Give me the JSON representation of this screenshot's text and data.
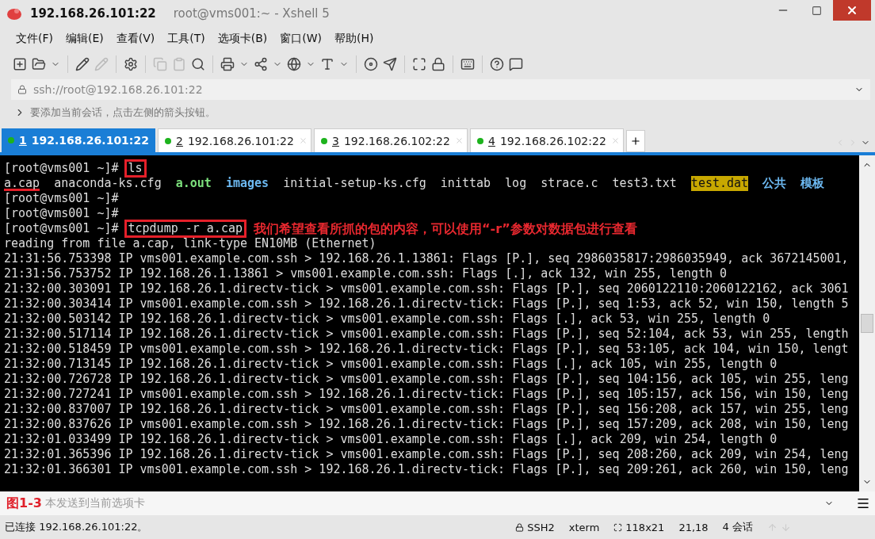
{
  "window": {
    "title": "192.168.26.101:22",
    "subtitle": "root@vms001:~ - Xshell 5"
  },
  "menu": [
    "文件(F)",
    "编辑(E)",
    "查看(V)",
    "工具(T)",
    "选项卡(B)",
    "窗口(W)",
    "帮助(H)"
  ],
  "address": {
    "value": "ssh://root@192.168.26.101:22"
  },
  "hint": "要添加当前会话，点击左侧的箭头按钮。",
  "tabs": [
    {
      "number": "1",
      "label": "192.168.26.101:22",
      "selected": true
    },
    {
      "number": "2",
      "label": "192.168.26.101:22",
      "selected": false
    },
    {
      "number": "3",
      "label": "192.168.26.102:22",
      "selected": false
    },
    {
      "number": "4",
      "label": "192.168.26.102:22",
      "selected": false
    }
  ],
  "terminal": [
    [
      {
        "kind": "plain",
        "text": "[root@vms001 ~]#"
      },
      {
        "kind": "command",
        "text": "ls"
      }
    ],
    [
      {
        "kind": "marked",
        "text": "a.cap"
      },
      {
        "kind": "file",
        "text": "anaconda-ks.cfg"
      },
      {
        "kind": "exec",
        "text": "a.out"
      },
      {
        "kind": "dir",
        "text": "images"
      },
      {
        "kind": "file",
        "text": "initial-setup-ks.cfg"
      },
      {
        "kind": "file",
        "text": "inittab"
      },
      {
        "kind": "file",
        "text": "log"
      },
      {
        "kind": "file",
        "text": "strace.c"
      },
      {
        "kind": "file",
        "text": "test3.txt"
      },
      {
        "kind": "highlight",
        "text": "test.dat"
      },
      {
        "kind": "dir",
        "text": "公共"
      },
      {
        "kind": "dir",
        "text": "模板"
      }
    ],
    [
      {
        "kind": "plain",
        "text": "[root@vms001 ~]#"
      }
    ],
    [
      {
        "kind": "plain",
        "text": "[root@vms001 ~]#"
      }
    ],
    [
      {
        "kind": "plain",
        "text": "[root@vms001 ~]#"
      },
      {
        "kind": "command",
        "text": "tcpdump -r a.cap"
      },
      {
        "kind": "note",
        "text": "我们希望查看所抓的包的内容，可以使用“-r”参数对数据包进行查看"
      }
    ],
    [
      {
        "kind": "plain",
        "text": "reading from file a.cap, link-type EN10MB (Ethernet)"
      }
    ],
    [
      {
        "kind": "plain",
        "text": "21:31:56.753398 IP vms001.example.com.ssh > 192.168.26.1.13861: Flags [P.], seq 2986035817:2986035949, ack 3672145001,"
      }
    ],
    [
      {
        "kind": "plain",
        "text": "21:31:56.753752 IP 192.168.26.1.13861 > vms001.example.com.ssh: Flags [.], ack 132, win 255, length 0"
      }
    ],
    [
      {
        "kind": "plain",
        "text": "21:32:00.303091 IP 192.168.26.1.directv-tick > vms001.example.com.ssh: Flags [P.], seq 2060122110:2060122162, ack 3061"
      }
    ],
    [
      {
        "kind": "plain",
        "text": "21:32:00.303414 IP vms001.example.com.ssh > 192.168.26.1.directv-tick: Flags [P.], seq 1:53, ack 52, win 150, length 5"
      }
    ],
    [
      {
        "kind": "plain",
        "text": "21:32:00.503142 IP 192.168.26.1.directv-tick > vms001.example.com.ssh: Flags [.], ack 53, win 255, length 0"
      }
    ],
    [
      {
        "kind": "plain",
        "text": "21:32:00.517114 IP 192.168.26.1.directv-tick > vms001.example.com.ssh: Flags [P.], seq 52:104, ack 53, win 255, length"
      }
    ],
    [
      {
        "kind": "plain",
        "text": "21:32:00.518459 IP vms001.example.com.ssh > 192.168.26.1.directv-tick: Flags [P.], seq 53:105, ack 104, win 150, lengt"
      }
    ],
    [
      {
        "kind": "plain",
        "text": "21:32:00.713145 IP 192.168.26.1.directv-tick > vms001.example.com.ssh: Flags [.], ack 105, win 255, length 0"
      }
    ],
    [
      {
        "kind": "plain",
        "text": "21:32:00.726728 IP 192.168.26.1.directv-tick > vms001.example.com.ssh: Flags [P.], seq 104:156, ack 105, win 255, leng"
      }
    ],
    [
      {
        "kind": "plain",
        "text": "21:32:00.727241 IP vms001.example.com.ssh > 192.168.26.1.directv-tick: Flags [P.], seq 105:157, ack 156, win 150, leng"
      }
    ],
    [
      {
        "kind": "plain",
        "text": "21:32:00.837007 IP 192.168.26.1.directv-tick > vms001.example.com.ssh: Flags [P.], seq 156:208, ack 157, win 255, leng"
      }
    ],
    [
      {
        "kind": "plain",
        "text": "21:32:00.837626 IP vms001.example.com.ssh > 192.168.26.1.directv-tick: Flags [P.], seq 157:209, ack 208, win 150, leng"
      }
    ],
    [
      {
        "kind": "plain",
        "text": "21:32:01.033499 IP 192.168.26.1.directv-tick > vms001.example.com.ssh: Flags [.], ack 209, win 254, length 0"
      }
    ],
    [
      {
        "kind": "plain",
        "text": "21:32:01.365396 IP 192.168.26.1.directv-tick > vms001.example.com.ssh: Flags [P.], seq 208:260, ack 209, win 254, leng"
      }
    ],
    [
      {
        "kind": "plain",
        "text": "21:32:01.366301 IP vms001.example.com.ssh > 192.168.26.1.directv-tick: Flags [P.], seq 209:261, ack 260, win 150, leng"
      }
    ]
  ],
  "send_bar": {
    "figure_label": "图1-3",
    "placeholder": "本发送到当前选项卡"
  },
  "status_bar": {
    "message": "已连接 192.168.26.101:22。",
    "protocol": "SSH2",
    "terminal_type": "xterm",
    "size": "118x21",
    "cursor": "21,18",
    "sessions": "4 会话"
  }
}
